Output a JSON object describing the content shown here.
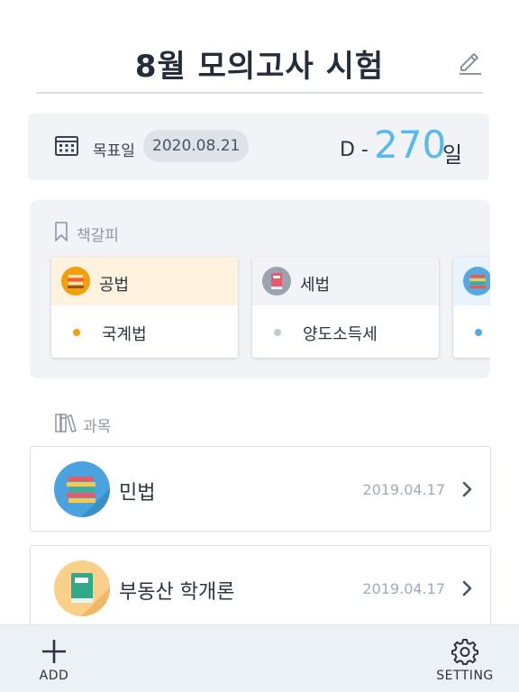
{
  "header": {
    "title": "8월 모의고사 시험"
  },
  "goal": {
    "label": "목표일",
    "date": "2020.08.21",
    "dday_prefix": "D -",
    "dday_value": "270",
    "dday_suffix": "일"
  },
  "bookmarks": {
    "heading": "책갈피",
    "items": [
      {
        "title": "공법",
        "entry": "국계법"
      },
      {
        "title": "세법",
        "entry": "양도소득세"
      },
      {
        "title": "",
        "entry": ""
      }
    ]
  },
  "subjects": {
    "heading": "과목",
    "items": [
      {
        "name": "민법",
        "date": "2019.04.17"
      },
      {
        "name": "부동산 학개론",
        "date": "2019.04.17"
      }
    ]
  },
  "bottom_nav": {
    "add_label": "ADD",
    "setting_label": "SETTING"
  },
  "colors": {
    "accent_blue": "#56b9f0",
    "bookmark1_bg": "#fff3e0",
    "bookmark1_dot": "#f59e0b",
    "bookmark2_bg": "#f1f3f6",
    "bookmark2_dot": "#c3c9d2",
    "bookmark3_bg": "#e9f3fc",
    "bookmark3_dot": "#56a8e0"
  }
}
